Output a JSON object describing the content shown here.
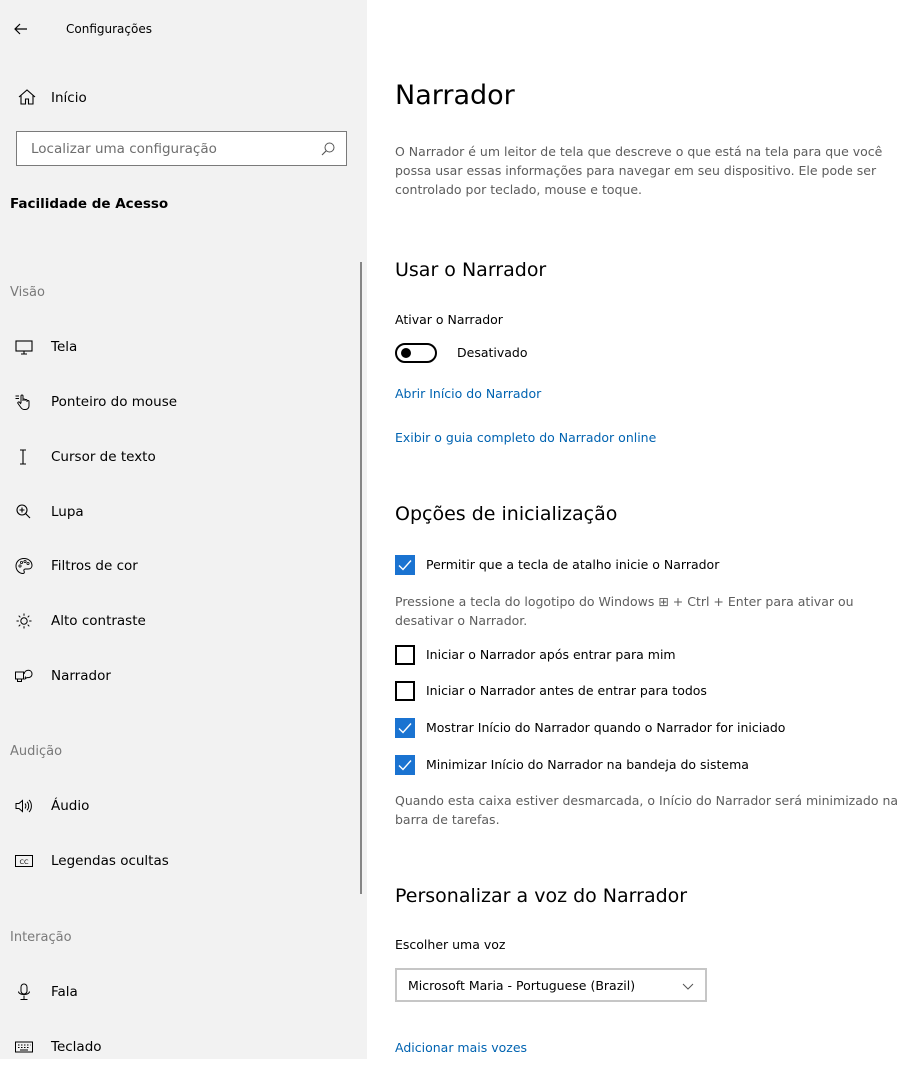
{
  "app": {
    "title": "Configurações"
  },
  "sidebar": {
    "home_label": "Início",
    "search": {
      "placeholder": "Localizar uma configuração"
    },
    "section_title": "Facilidade de Acesso",
    "groups": {
      "vision": "Visão",
      "hearing": "Audição",
      "interaction": "Interação"
    },
    "items": {
      "display": "Tela",
      "mouse_pointer": "Ponteiro do mouse",
      "text_cursor": "Cursor de texto",
      "magnifier": "Lupa",
      "color_filters": "Filtros de cor",
      "high_contrast": "Alto contraste",
      "narrator": "Narrador",
      "audio": "Áudio",
      "closed_captions": "Legendas ocultas",
      "speech": "Fala",
      "keyboard": "Teclado"
    }
  },
  "main": {
    "title": "Narrador",
    "description": "O Narrador é um leitor de tela que descreve o que está na tela para que você possa usar essas informações para navegar em seu dispositivo. Ele pode ser controlado por teclado, mouse e toque.",
    "use_narrator": {
      "heading": "Usar o Narrador",
      "toggle_label": "Ativar o Narrador",
      "toggle_state": "Desativado",
      "toggle_on": false,
      "link_home": "Abrir Início do Narrador",
      "link_guide": "Exibir o guia completo do Narrador online"
    },
    "startup": {
      "heading": "Opções de inicialização",
      "shortcut": {
        "label": "Permitir que a tecla de atalho inicie o Narrador",
        "checked": true
      },
      "shortcut_help": "Pressione a tecla do logotipo do Windows ⊞ + Ctrl + Enter para ativar ou desativar o Narrador.",
      "after_signin": {
        "label": "Iniciar o Narrador após entrar para mim",
        "checked": false
      },
      "before_signin": {
        "label": "Iniciar o Narrador antes de entrar para todos",
        "checked": false
      },
      "show_home": {
        "label": "Mostrar Início do Narrador quando o Narrador for iniciado",
        "checked": true
      },
      "minimize_home": {
        "label": "Minimizar Início do Narrador na bandeja do sistema",
        "checked": true
      },
      "minimize_help": "Quando esta caixa estiver desmarcada, o Início do Narrador será minimizado na barra de tarefas."
    },
    "voice": {
      "heading": "Personalizar a voz do Narrador",
      "choose_label": "Escolher uma voz",
      "selected_voice": "Microsoft Maria - Portuguese (Brazil)",
      "add_voices_link": "Adicionar mais vozes"
    }
  },
  "colors": {
    "sidebar_bg": "#f2f2f2",
    "accent": "#1a73d1",
    "link": "#0063b1",
    "muted_text": "#5d5d5d"
  }
}
